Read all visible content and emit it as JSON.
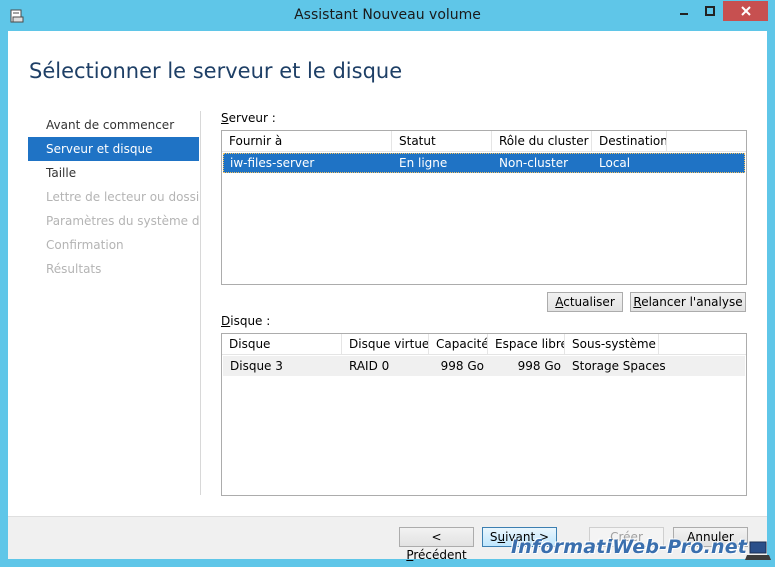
{
  "window": {
    "title": "Assistant Nouveau volume"
  },
  "header": {
    "title": "Sélectionner le serveur et le disque"
  },
  "nav": {
    "items": [
      {
        "label": "Avant de commencer",
        "state": "normal"
      },
      {
        "label": "Serveur et disque",
        "state": "active"
      },
      {
        "label": "Taille",
        "state": "normal"
      },
      {
        "label": "Lettre de lecteur ou dossier",
        "state": "disabled"
      },
      {
        "label": "Paramètres du système d...",
        "state": "disabled"
      },
      {
        "label": "Confirmation",
        "state": "disabled"
      },
      {
        "label": "Résultats",
        "state": "disabled"
      }
    ]
  },
  "server": {
    "label_prefix": "S",
    "label_rest": "erveur :",
    "columns": [
      "Fournir à",
      "Statut",
      "Rôle du cluster",
      "Destination"
    ],
    "rows": [
      {
        "provider": "iw-files-server",
        "status": "En ligne",
        "cluster_role": "Non-cluster",
        "destination": "Local",
        "selected": true
      }
    ],
    "refresh_prefix": "A",
    "refresh_rest": "ctualiser",
    "rescan_prefix": "R",
    "rescan_rest": "elancer l'analyse"
  },
  "disk": {
    "label_prefix": "D",
    "label_rest": "isque :",
    "columns": [
      "Disque",
      "Disque virtuel",
      "Capacité",
      "Espace libre",
      "Sous-système"
    ],
    "rows": [
      {
        "disk": "Disque 3",
        "virtual_disk": "RAID 0",
        "capacity": "998 Go",
        "free_space": "998 Go",
        "subsystem": "Storage Spaces"
      }
    ]
  },
  "footer": {
    "previous_prefix": "< ",
    "previous_u": "P",
    "previous_rest": "récédent",
    "next_prefix": "S",
    "next_u": "u",
    "next_rest": "ivant >",
    "create_label": "Créer",
    "cancel_label": "Annuler"
  },
  "watermark": {
    "text": "InformatiWeb-Pro.net"
  },
  "colors": {
    "accent": "#1f73c5",
    "titlebar": "#5fc6e8",
    "close": "#c75050",
    "header_text": "#1e3f66"
  }
}
